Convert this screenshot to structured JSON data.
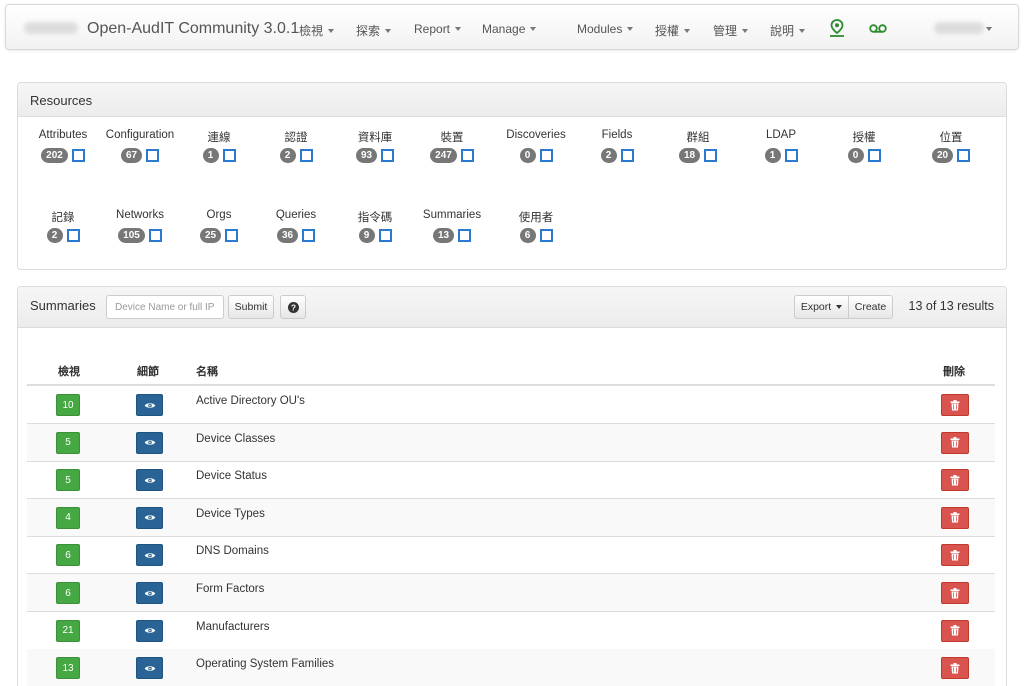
{
  "navbar": {
    "brand": "Open-AudIT Community 3.0.1",
    "menu": [
      {
        "label": "檢視"
      },
      {
        "label": "探索"
      },
      {
        "label": "Report"
      },
      {
        "label": "Manage"
      },
      {
        "label": "Modules"
      },
      {
        "label": "授權"
      },
      {
        "label": "管理"
      },
      {
        "label": "說明"
      }
    ],
    "icons": [
      "map-pin-icon",
      "voicemail-icon"
    ]
  },
  "resources": {
    "title": "Resources",
    "items": [
      {
        "label": "Attributes",
        "count": "202"
      },
      {
        "label": "Configuration",
        "count": "67"
      },
      {
        "label": "連線",
        "count": "1"
      },
      {
        "label": "認證",
        "count": "2"
      },
      {
        "label": "資料庫",
        "count": "93"
      },
      {
        "label": "裝置",
        "count": "247"
      },
      {
        "label": "Discoveries",
        "count": "0"
      },
      {
        "label": "Fields",
        "count": "2"
      },
      {
        "label": "群組",
        "count": "18"
      },
      {
        "label": "LDAP",
        "count": "1"
      },
      {
        "label": "授權",
        "count": "0"
      },
      {
        "label": "位置",
        "count": "20"
      },
      {
        "label": "記錄",
        "count": "2"
      },
      {
        "label": "Networks",
        "count": "105"
      },
      {
        "label": "Orgs",
        "count": "25"
      },
      {
        "label": "Queries",
        "count": "36"
      },
      {
        "label": "指令碼",
        "count": "9"
      },
      {
        "label": "Summaries",
        "count": "13"
      },
      {
        "label": "使用者",
        "count": "6"
      }
    ]
  },
  "summaries": {
    "title": "Summaries",
    "search_placeholder": "Device Name or full IP",
    "submit_label": "Submit",
    "export_label": "Export",
    "create_label": "Create",
    "results_text": "13 of 13 results",
    "columns": {
      "view": "檢視",
      "details": "細節",
      "name": "名稱",
      "delete": "刪除"
    },
    "rows": [
      {
        "count": "10",
        "name": "Active Directory OU's"
      },
      {
        "count": "5",
        "name": "Device Classes"
      },
      {
        "count": "5",
        "name": "Device Status"
      },
      {
        "count": "4",
        "name": "Device Types"
      },
      {
        "count": "6",
        "name": "DNS Domains"
      },
      {
        "count": "6",
        "name": "Form Factors"
      },
      {
        "count": "21",
        "name": "Manufacturers"
      },
      {
        "count": "13",
        "name": "Operating System Families"
      }
    ]
  },
  "colors": {
    "view_button": "#45a843",
    "details_button": "#2a6496",
    "delete_button": "#d9534f",
    "checkbox": "#2a7bd0",
    "badge": "#777777"
  }
}
